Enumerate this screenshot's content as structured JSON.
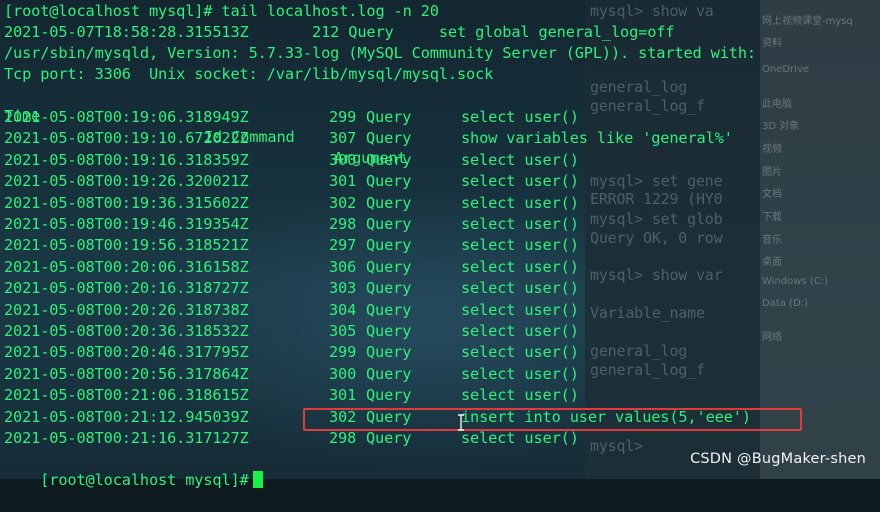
{
  "terminal": {
    "command_line": "[root@localhost mysql]# tail localhost.log -n 20",
    "header_lines": [
      "2021-05-07T18:58:28.315513Z       212 Query     set global general_log=off",
      "/usr/sbin/mysqld, Version: 5.7.33-log (MySQL Community Server (GPL)). started with:",
      "Tcp port: 3306  Unix socket: /var/lib/mysql/mysql.sock"
    ],
    "columns": [
      "Time",
      "Id Command",
      "Argument"
    ],
    "rows": [
      {
        "time": "2021-05-08T00:19:06.318949Z",
        "id": "299",
        "command": "Query",
        "argument": "select user()"
      },
      {
        "time": "2021-05-08T00:19:10.672022Z",
        "id": "307",
        "command": "Query",
        "argument": "show variables like 'general%'"
      },
      {
        "time": "2021-05-08T00:19:16.318359Z",
        "id": "300",
        "command": "Query",
        "argument": "select user()"
      },
      {
        "time": "2021-05-08T00:19:26.320021Z",
        "id": "301",
        "command": "Query",
        "argument": "select user()"
      },
      {
        "time": "2021-05-08T00:19:36.315602Z",
        "id": "302",
        "command": "Query",
        "argument": "select user()"
      },
      {
        "time": "2021-05-08T00:19:46.319354Z",
        "id": "298",
        "command": "Query",
        "argument": "select user()"
      },
      {
        "time": "2021-05-08T00:19:56.318521Z",
        "id": "297",
        "command": "Query",
        "argument": "select user()"
      },
      {
        "time": "2021-05-08T00:20:06.316158Z",
        "id": "306",
        "command": "Query",
        "argument": "select user()"
      },
      {
        "time": "2021-05-08T00:20:16.318727Z",
        "id": "303",
        "command": "Query",
        "argument": "select user()"
      },
      {
        "time": "2021-05-08T00:20:26.318738Z",
        "id": "304",
        "command": "Query",
        "argument": "select user()"
      },
      {
        "time": "2021-05-08T00:20:36.318532Z",
        "id": "305",
        "command": "Query",
        "argument": "select user()"
      },
      {
        "time": "2021-05-08T00:20:46.317795Z",
        "id": "299",
        "command": "Query",
        "argument": "select user()"
      },
      {
        "time": "2021-05-08T00:20:56.317864Z",
        "id": "300",
        "command": "Query",
        "argument": "select user()"
      },
      {
        "time": "2021-05-08T00:21:06.318615Z",
        "id": "301",
        "command": "Query",
        "argument": "select user()"
      },
      {
        "time": "2021-05-08T00:21:12.945039Z",
        "id": "302",
        "command": "Query",
        "argument": "insert into user values(5,'eee')"
      },
      {
        "time": "2021-05-08T00:21:16.317127Z",
        "id": "298",
        "command": "Query",
        "argument": "select user()"
      }
    ],
    "prompt": "[root@localhost mysql]#"
  },
  "background": {
    "mysql_lines": [
      "mysql> show va",
      "general_log",
      "general_log_f",
      "mysql> set gene",
      "ERROR 1229 (HY0",
      "mysql> set glob",
      "Query OK, 0 row",
      "mysql> show var",
      "Variable_name",
      "general_log",
      "general_log_f",
      "mysql>"
    ],
    "side_items": [
      "网上视频课堂-mysq",
      "资料",
      "OneDrive",
      "此电脑",
      "3D 对象",
      "视频",
      "图片",
      "文档",
      "下载",
      "音乐",
      "桌面",
      "Windows (C:)",
      "Data (D:)",
      "网络"
    ]
  },
  "watermark": "CSDN @BugMaker-shen",
  "colors": {
    "terminal_text": "#2ef07a",
    "highlight_border": "#e23a3a",
    "cursor": "#16f04c"
  }
}
